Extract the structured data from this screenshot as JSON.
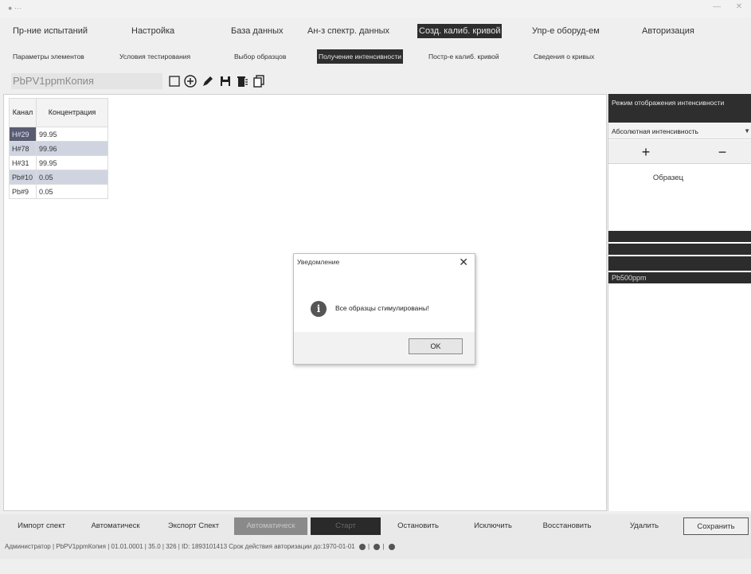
{
  "menu": [
    {
      "label": "Пр-ние испытаний",
      "active": false
    },
    {
      "label": "Настройка",
      "active": false
    },
    {
      "label": "База данных",
      "active": false
    },
    {
      "label": "Ан-з спектр. данных",
      "active": false
    },
    {
      "label": "Созд. калиб. кривой",
      "active": true
    },
    {
      "label": "Упр-е оборуд-ем",
      "active": false
    },
    {
      "label": "Авторизация",
      "active": false
    }
  ],
  "submenu": [
    {
      "label": "Параметры элементов",
      "active": false
    },
    {
      "label": "Условия тестирования",
      "active": false
    },
    {
      "label": "Выбор образцов",
      "active": false
    },
    {
      "label": "Получение интенсивности",
      "active": true
    },
    {
      "label": "Постр-е калиб. кривой",
      "active": false
    },
    {
      "label": "Сведения о кривых",
      "active": false
    }
  ],
  "profile_name": "PbPV1ppmКопия",
  "toolbar_icons": [
    "new-icon",
    "add-circle-icon",
    "edit-icon",
    "save-icon",
    "delete-icon",
    "copy-icon"
  ],
  "grid": {
    "headers": [
      "Канал",
      "Концентрация"
    ],
    "rows": [
      {
        "channel": "H#29",
        "value": "99.95"
      },
      {
        "channel": "H#78",
        "value": "99.96"
      },
      {
        "channel": "H#31",
        "value": "99.95"
      },
      {
        "channel": "Pb#10",
        "value": "0.05"
      },
      {
        "channel": "Pb#9",
        "value": "0.05"
      }
    ]
  },
  "right_panel": {
    "mode_header": "Режим отображения интенсивности",
    "mode_value": "Абсолютная интенсивность",
    "plus": "+",
    "minus": "−",
    "sample_header": "Образец",
    "sample_row": "Pb500ppm"
  },
  "dialog": {
    "title": "Уведомление",
    "close": "✕",
    "icon": "i",
    "message": "Все образцы стимулированы!",
    "ok": "OK"
  },
  "bottom_buttons": [
    {
      "label": "Импорт спект",
      "style": "normal"
    },
    {
      "label": "Автоматическ",
      "style": "normal"
    },
    {
      "label": "Экспорт Спект",
      "style": "normal"
    },
    {
      "label": "Автоматическ",
      "style": "hl"
    },
    {
      "label": "Старт",
      "style": "dark"
    },
    {
      "label": "Остановить",
      "style": "normal"
    },
    {
      "label": "Исключить",
      "style": "normal"
    },
    {
      "label": "Восстановить",
      "style": "normal"
    },
    {
      "label": "Удалить",
      "style": "normal"
    },
    {
      "label": "Сохранить",
      "style": "boxed"
    }
  ],
  "status": {
    "user": "Администратор",
    "profile": "PbPV1ppmКопия",
    "date": "01.01.0001",
    "v1": "35.0",
    "v2": "326",
    "id": "ID: 1893101413",
    "expiry": "Срок действия авторизации до:1970-01-01"
  }
}
